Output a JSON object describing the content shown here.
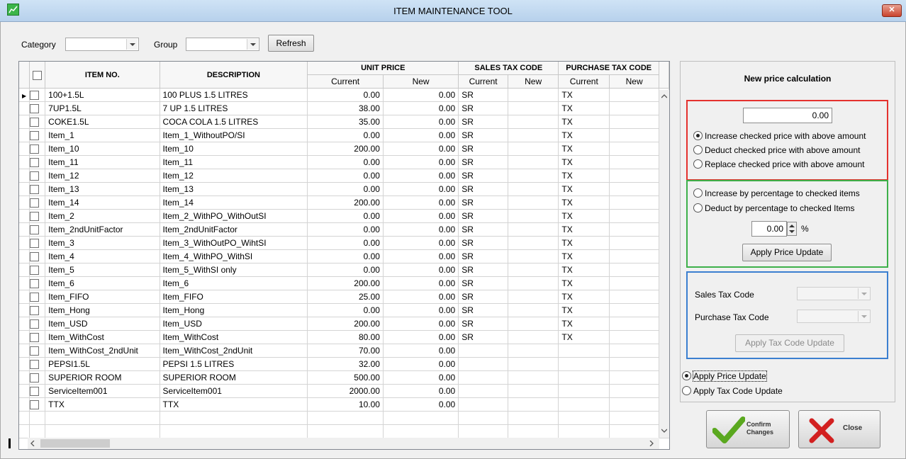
{
  "window": {
    "title": "ITEM MAINTENANCE TOOL",
    "close_label": "✕"
  },
  "toolbar": {
    "category_label": "Category",
    "category_value": "",
    "group_label": "Group",
    "group_value": "",
    "refresh_label": "Refresh"
  },
  "grid": {
    "headers": {
      "item_no": "ITEM NO.",
      "description": "DESCRIPTION",
      "unit_price": "UNIT PRICE",
      "sales_tax_code": "SALES TAX CODE",
      "purchase_tax_code": "PURCHASE TAX CODE",
      "current": "Current",
      "new": "New"
    },
    "rows": [
      {
        "item": "100+1.5L",
        "desc": "100 PLUS 1.5 LITRES",
        "cur": "0.00",
        "new": "0.00",
        "stc": "SR",
        "stn": "",
        "ptc": "TX",
        "ptn": ""
      },
      {
        "item": "7UP1.5L",
        "desc": "7 UP 1.5 LITRES",
        "cur": "38.00",
        "new": "0.00",
        "stc": "SR",
        "stn": "",
        "ptc": "TX",
        "ptn": ""
      },
      {
        "item": "COKE1.5L",
        "desc": "COCA COLA 1.5 LITRES",
        "cur": "35.00",
        "new": "0.00",
        "stc": "SR",
        "stn": "",
        "ptc": "TX",
        "ptn": ""
      },
      {
        "item": "Item_1",
        "desc": "Item_1_WithoutPO/SI",
        "cur": "0.00",
        "new": "0.00",
        "stc": "SR",
        "stn": "",
        "ptc": "TX",
        "ptn": ""
      },
      {
        "item": "Item_10",
        "desc": "Item_10",
        "cur": "200.00",
        "new": "0.00",
        "stc": "SR",
        "stn": "",
        "ptc": "TX",
        "ptn": ""
      },
      {
        "item": "Item_11",
        "desc": "Item_11",
        "cur": "0.00",
        "new": "0.00",
        "stc": "SR",
        "stn": "",
        "ptc": "TX",
        "ptn": ""
      },
      {
        "item": "Item_12",
        "desc": "Item_12",
        "cur": "0.00",
        "new": "0.00",
        "stc": "SR",
        "stn": "",
        "ptc": "TX",
        "ptn": ""
      },
      {
        "item": "Item_13",
        "desc": "Item_13",
        "cur": "0.00",
        "new": "0.00",
        "stc": "SR",
        "stn": "",
        "ptc": "TX",
        "ptn": ""
      },
      {
        "item": "Item_14",
        "desc": "Item_14",
        "cur": "200.00",
        "new": "0.00",
        "stc": "SR",
        "stn": "",
        "ptc": "TX",
        "ptn": ""
      },
      {
        "item": "Item_2",
        "desc": "Item_2_WithPO_WithOutSI",
        "cur": "0.00",
        "new": "0.00",
        "stc": "SR",
        "stn": "",
        "ptc": "TX",
        "ptn": ""
      },
      {
        "item": "Item_2ndUnitFactor",
        "desc": "Item_2ndUnitFactor",
        "cur": "0.00",
        "new": "0.00",
        "stc": "SR",
        "stn": "",
        "ptc": "TX",
        "ptn": ""
      },
      {
        "item": "Item_3",
        "desc": "Item_3_WithOutPO_WihtSI",
        "cur": "0.00",
        "new": "0.00",
        "stc": "SR",
        "stn": "",
        "ptc": "TX",
        "ptn": ""
      },
      {
        "item": "Item_4",
        "desc": "Item_4_WithPO_WithSI",
        "cur": "0.00",
        "new": "0.00",
        "stc": "SR",
        "stn": "",
        "ptc": "TX",
        "ptn": ""
      },
      {
        "item": "Item_5",
        "desc": "Item_5_WithSI only",
        "cur": "0.00",
        "new": "0.00",
        "stc": "SR",
        "stn": "",
        "ptc": "TX",
        "ptn": ""
      },
      {
        "item": "Item_6",
        "desc": "Item_6",
        "cur": "200.00",
        "new": "0.00",
        "stc": "SR",
        "stn": "",
        "ptc": "TX",
        "ptn": ""
      },
      {
        "item": "Item_FIFO",
        "desc": "Item_FIFO",
        "cur": "25.00",
        "new": "0.00",
        "stc": "SR",
        "stn": "",
        "ptc": "TX",
        "ptn": ""
      },
      {
        "item": "Item_Hong",
        "desc": "Item_Hong",
        "cur": "0.00",
        "new": "0.00",
        "stc": "SR",
        "stn": "",
        "ptc": "TX",
        "ptn": ""
      },
      {
        "item": "Item_USD",
        "desc": "Item_USD",
        "cur": "200.00",
        "new": "0.00",
        "stc": "SR",
        "stn": "",
        "ptc": "TX",
        "ptn": ""
      },
      {
        "item": "Item_WithCost",
        "desc": "Item_WithCost",
        "cur": "80.00",
        "new": "0.00",
        "stc": "SR",
        "stn": "",
        "ptc": "TX",
        "ptn": ""
      },
      {
        "item": "Item_WithCost_2ndUnit",
        "desc": "Item_WithCost_2ndUnit",
        "cur": "70.00",
        "new": "0.00",
        "stc": "",
        "stn": "",
        "ptc": "",
        "ptn": ""
      },
      {
        "item": "PEPSI1.5L",
        "desc": "PEPSI 1.5 LITRES",
        "cur": "32.00",
        "new": "0.00",
        "stc": "",
        "stn": "",
        "ptc": "",
        "ptn": ""
      },
      {
        "item": "SUPERIOR ROOM",
        "desc": "SUPERIOR ROOM",
        "cur": "500.00",
        "new": "0.00",
        "stc": "",
        "stn": "",
        "ptc": "",
        "ptn": ""
      },
      {
        "item": "ServiceItem001",
        "desc": "ServiceItem001",
        "cur": "2000.00",
        "new": "0.00",
        "stc": "",
        "stn": "",
        "ptc": "",
        "ptn": ""
      },
      {
        "item": "TTX",
        "desc": "TTX",
        "cur": "10.00",
        "new": "0.00",
        "stc": "",
        "stn": "",
        "ptc": "",
        "ptn": ""
      }
    ]
  },
  "panel": {
    "heading": "New price calculation",
    "amount_value": "0.00",
    "radio_increase_amount": "Increase checked price with above amount",
    "radio_deduct_amount": "Deduct checked price with above amount",
    "radio_replace_amount": "Replace checked price with above amount",
    "radio_increase_pct": "Increase by percentage to checked items",
    "radio_deduct_pct": "Deduct by percentage to checked Items",
    "percent_value": "0.00",
    "percent_sign": "%",
    "apply_price_button": "Apply Price Update",
    "sales_tax_label": "Sales Tax Code",
    "purchase_tax_label": "Purchase Tax Code",
    "apply_tax_button": "Apply Tax Code Update",
    "mode_apply_price": "Apply Price Update",
    "mode_apply_tax": "Apply Tax Code Update",
    "confirm_button": "Confirm Changes",
    "close_button": "Close",
    "colors": {
      "red_box": "#e5312e",
      "green_box": "#3db04a",
      "blue_box": "#3b7fd0"
    }
  }
}
